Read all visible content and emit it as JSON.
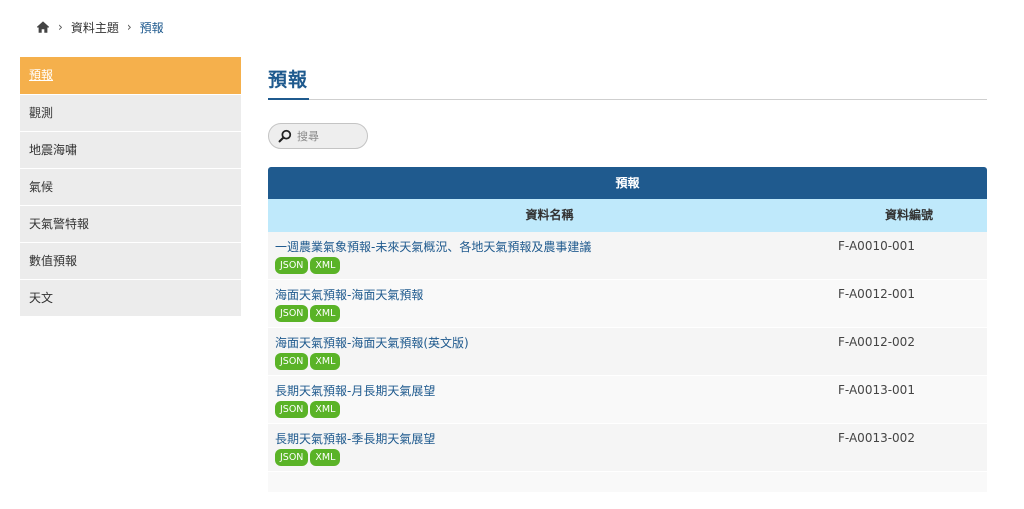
{
  "breadcrumb": {
    "home_icon": "home-icon",
    "separator": "›",
    "items": [
      "資料主題",
      "預報"
    ]
  },
  "sidebar": {
    "items": [
      {
        "label": "預報",
        "active": true
      },
      {
        "label": "觀測"
      },
      {
        "label": "地震海嘯"
      },
      {
        "label": "氣候"
      },
      {
        "label": "天氣警特報"
      },
      {
        "label": "數值預報"
      },
      {
        "label": "天文"
      }
    ]
  },
  "main": {
    "title": "預報",
    "search": {
      "placeholder": "搜尋",
      "icon": "search-icon"
    }
  },
  "table": {
    "group_header": "預報",
    "columns": [
      "資料名稱",
      "資料編號"
    ],
    "rows": [
      {
        "name": "一週農業氣象預報-未來天氣概況、各地天氣預報及農事建議",
        "id": "F-A0010-001",
        "formats": [
          "JSON",
          "XML"
        ]
      },
      {
        "name": "海面天氣預報-海面天氣預報",
        "id": "F-A0012-001",
        "formats": [
          "JSON",
          "XML"
        ]
      },
      {
        "name": "海面天氣預報-海面天氣預報(英文版)",
        "id": "F-A0012-002",
        "formats": [
          "JSON",
          "XML"
        ]
      },
      {
        "name": "長期天氣預報-月長期天氣展望",
        "id": "F-A0013-001",
        "formats": [
          "JSON",
          "XML"
        ]
      },
      {
        "name": "長期天氣預報-季長期天氣展望",
        "id": "F-A0013-002",
        "formats": [
          "JSON",
          "XML"
        ]
      }
    ]
  },
  "colors": {
    "primary": "#1f5a8e",
    "accent": "#f5b04c",
    "header_light": "#bfe9fb",
    "badge": "#5ab327"
  }
}
